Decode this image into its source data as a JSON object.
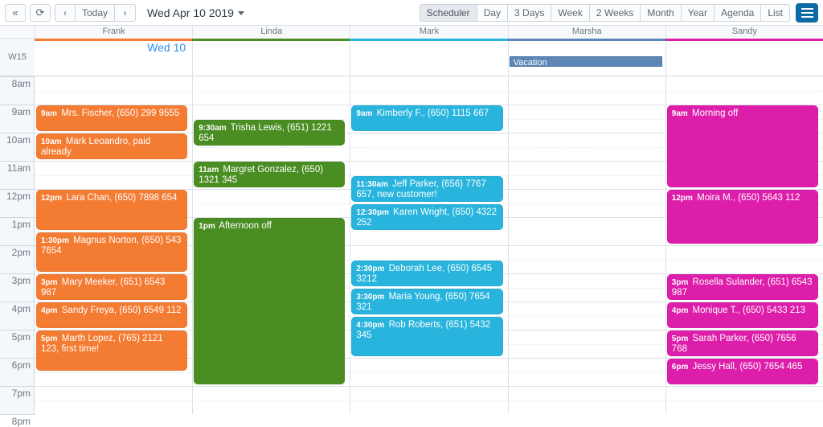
{
  "toolbar": {
    "first_icon": "«",
    "refresh_icon": "⟳",
    "prev_icon": "‹",
    "today_label": "Today",
    "next_icon": "›",
    "date_label": "Wed Apr 10 2019",
    "views": [
      {
        "label": "Scheduler",
        "active": true
      },
      {
        "label": "Day",
        "active": false
      },
      {
        "label": "3 Days",
        "active": false
      },
      {
        "label": "Week",
        "active": false
      },
      {
        "label": "2 Weeks",
        "active": false
      },
      {
        "label": "Month",
        "active": false
      },
      {
        "label": "Year",
        "active": false
      },
      {
        "label": "Agenda",
        "active": false
      },
      {
        "label": "List",
        "active": false
      }
    ],
    "menu_icon": "hamburger-icon"
  },
  "calendar": {
    "week_label": "W15",
    "day_label": "Wed 10",
    "hour_labels": [
      "8am",
      "9am",
      "10am",
      "11am",
      "12pm",
      "1pm",
      "2pm",
      "3pm",
      "4pm",
      "5pm",
      "6pm",
      "7pm",
      "8pm"
    ],
    "resources": [
      {
        "name": "Frank",
        "color": "#f47b32"
      },
      {
        "name": "Linda",
        "color": "#4a8d22"
      },
      {
        "name": "Mark",
        "color": "#29b4dd"
      },
      {
        "name": "Marsha",
        "color": "#5b86b5"
      },
      {
        "name": "Sandy",
        "color": "#dd1eaa"
      }
    ],
    "allday_events": [
      {
        "resource": "Marsha",
        "title": "Vacation",
        "color": "#5b86b5"
      }
    ],
    "events": [
      {
        "resource": "Frank",
        "time": "9am",
        "title": "Mrs. Fischer, (650) 299 9555",
        "start": 9.0,
        "end": 10.0,
        "color": "#f47b32"
      },
      {
        "resource": "Frank",
        "time": "10am",
        "title": "Mark Leoandro, paid already",
        "start": 10.0,
        "end": 11.0,
        "color": "#f47b32"
      },
      {
        "resource": "Frank",
        "time": "12pm",
        "title": "Lara Chan, (650) 7898 654",
        "start": 12.0,
        "end": 13.5,
        "color": "#f47b32"
      },
      {
        "resource": "Frank",
        "time": "1:30pm",
        "title": "Magnus Norton, (650) 543 7654",
        "start": 13.5,
        "end": 15.0,
        "color": "#f47b32"
      },
      {
        "resource": "Frank",
        "time": "3pm",
        "title": "Mary Meeker, (651) 6543 987",
        "start": 15.0,
        "end": 16.0,
        "color": "#f47b32"
      },
      {
        "resource": "Frank",
        "time": "4pm",
        "title": "Sandy Freya, (650) 6549 112",
        "start": 16.0,
        "end": 17.0,
        "color": "#f47b32"
      },
      {
        "resource": "Frank",
        "time": "5pm",
        "title": "Marth Lopez, (765) 2121 123, first time!",
        "start": 17.0,
        "end": 18.5,
        "color": "#f47b32"
      },
      {
        "resource": "Linda",
        "time": "9:30am",
        "title": "Trisha Lewis, (651) 1221 654",
        "start": 9.5,
        "end": 10.5,
        "color": "#4a8d22"
      },
      {
        "resource": "Linda",
        "time": "11am",
        "title": "Margret Gonzalez, (650) 1321 345",
        "start": 11.0,
        "end": 12.0,
        "color": "#4a8d22"
      },
      {
        "resource": "Linda",
        "time": "1pm",
        "title": "Afternoon off",
        "start": 13.0,
        "end": 19.0,
        "color": "#4a8d22"
      },
      {
        "resource": "Mark",
        "time": "9am",
        "title": "Kimberly F., (650) 1115 667",
        "start": 9.0,
        "end": 10.0,
        "color": "#29b4dd"
      },
      {
        "resource": "Mark",
        "time": "11:30am",
        "title": "Jeff Parker, (656) 7767 657, new customer!",
        "start": 11.5,
        "end": 12.5,
        "color": "#29b4dd"
      },
      {
        "resource": "Mark",
        "time": "12:30pm",
        "title": "Karen Wright, (650) 4322 252",
        "start": 12.5,
        "end": 13.5,
        "color": "#29b4dd"
      },
      {
        "resource": "Mark",
        "time": "2:30pm",
        "title": "Deborah Lee, (650) 6545 3212",
        "start": 14.5,
        "end": 15.5,
        "color": "#29b4dd"
      },
      {
        "resource": "Mark",
        "time": "3:30pm",
        "title": "Maria Young, (650) 7654 321",
        "start": 15.5,
        "end": 16.5,
        "color": "#29b4dd"
      },
      {
        "resource": "Mark",
        "time": "4:30pm",
        "title": "Rob Roberts, (651) 5432 345",
        "start": 16.5,
        "end": 18.0,
        "color": "#29b4dd"
      },
      {
        "resource": "Sandy",
        "time": "9am",
        "title": "Morning off",
        "start": 9.0,
        "end": 12.0,
        "color": "#dd1eaa"
      },
      {
        "resource": "Sandy",
        "time": "12pm",
        "title": "Moira M., (650) 5643 112",
        "start": 12.0,
        "end": 14.0,
        "color": "#dd1eaa"
      },
      {
        "resource": "Sandy",
        "time": "3pm",
        "title": "Rosella Sulander, (651) 6543 987",
        "start": 15.0,
        "end": 16.0,
        "color": "#dd1eaa"
      },
      {
        "resource": "Sandy",
        "time": "4pm",
        "title": "Monique T., (650) 5433 213",
        "start": 16.0,
        "end": 17.0,
        "color": "#dd1eaa"
      },
      {
        "resource": "Sandy",
        "time": "5pm",
        "title": "Sarah Parker, (650) 7656 768",
        "start": 17.0,
        "end": 18.0,
        "color": "#dd1eaa"
      },
      {
        "resource": "Sandy",
        "time": "6pm",
        "title": "Jessy Hall, (650) 7654 465",
        "start": 18.0,
        "end": 19.0,
        "color": "#dd1eaa"
      }
    ]
  }
}
